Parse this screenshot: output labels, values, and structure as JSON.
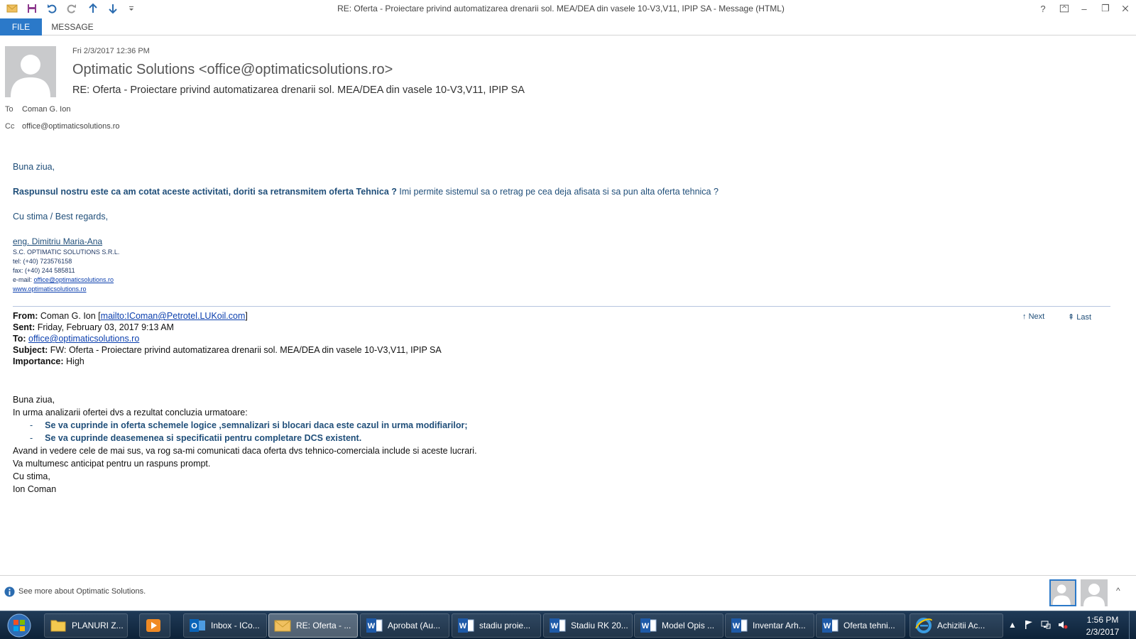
{
  "window": {
    "title": "RE: Oferta - Proiectare privind automatizarea drenarii sol. MEA/DEA din vasele 10-V3,V11, IPIP SA - Message (HTML)",
    "help": "?",
    "minimize": "–",
    "restore": "❐"
  },
  "ribbon": {
    "file_tab": "FILE",
    "message_tab": "MESSAGE"
  },
  "header": {
    "sent": "Fri 2/3/2017 12:36 PM",
    "sender": "Optimatic Solutions <office@optimaticsolutions.ro>",
    "subject": "RE: Oferta - Proiectare privind automatizarea drenarii sol. MEA/DEA din vasele 10-V3,V11, IPIP SA",
    "to_label": "To",
    "to_value": "Coman G. Ion",
    "cc_label": "Cc",
    "cc_value": "office@optimaticsolutions.ro"
  },
  "reply": {
    "greeting": "Buna ziua,",
    "bold_line": "Raspunsul nostru este ca am cotat aceste activitati, doriti sa retransmitem oferta Tehnica ?",
    "normal_line": " Imi permite sistemul sa o retrag pe cea deja afisata si sa pun alta oferta tehnica ?",
    "closing": "Cu stima / Best regards,",
    "signature": {
      "name": "eng. Dimitriu Maria-Ana",
      "company": "S.C. OPTIMATIC SOLUTIONS S.R.L.",
      "tel": "tel: (+40) 723576158",
      "fax": "fax:  (+40) 244 585811",
      "email_label": "e-mail: ",
      "email": "office@optimaticsolutions.ro",
      "website": "www.optimaticsolutions.ro"
    }
  },
  "forwarded": {
    "from_label": "From:",
    "from_value": " Coman G. Ion [",
    "from_link": "mailto:IComan@Petrotel.LUKoil.com",
    "from_close": "]",
    "sent_label": "Sent:",
    "sent_value": " Friday, February 03, 2017 9:13 AM",
    "to_label": "To:",
    "to_link": "office@optimaticsolutions.ro",
    "subject_label": "Subject:",
    "subject_value": " FW: Oferta - Proiectare privind automatizarea drenarii sol. MEA/DEA din vasele 10-V3,V11, IPIP SA",
    "importance_label": "Importance:",
    "importance_value": " High",
    "next": "Next",
    "last": "Last",
    "body": {
      "greeting": "Buna ziua,",
      "intro": "In urma analizarii ofertei dvs a rezultat concluzia urmatoare:",
      "bullet_dash": "-",
      "bullet1": "Se va cuprinde in oferta schemele logice ,semnalizari si blocari daca este cazul in urma modifiarilor;",
      "bullet2": "Se va cuprinde deasemenea si specificatii pentru completare DCS existent.",
      "line1": "Avand in vedere cele de mai sus, va rog sa-mi comunicati daca oferta dvs tehnico-comerciala include si aceste lucrari.",
      "line2": "Va multumesc anticipat pentru un raspuns prompt.",
      "line3": "Cu stima,",
      "line4": "Ion Coman"
    }
  },
  "people_pane": {
    "text": "See more about Optimatic Solutions."
  },
  "taskbar": {
    "items": [
      {
        "label": "PLANURI Z...",
        "icon": "folder-icon"
      },
      {
        "label": "",
        "icon": "media-player-icon"
      },
      {
        "label": "Inbox - ICo...",
        "icon": "outlook-icon"
      },
      {
        "label": "RE: Oferta - ...",
        "icon": "mail-icon"
      },
      {
        "label": "Aprobat (Au...",
        "icon": "word-icon"
      },
      {
        "label": "stadiu proie...",
        "icon": "word-icon"
      },
      {
        "label": "Stadiu RK 20...",
        "icon": "word-icon"
      },
      {
        "label": "Model Opis ...",
        "icon": "word-icon"
      },
      {
        "label": "Inventar Arh...",
        "icon": "word-icon"
      },
      {
        "label": "Oferta tehni...",
        "icon": "word-icon"
      },
      {
        "label": "Achizitii Ac...",
        "icon": "ie-icon"
      }
    ],
    "clock_time": "1:56 PM",
    "clock_date": "2/3/2017"
  },
  "colors": {
    "accent": "#2b79c9",
    "reply_text": "#1f4e79",
    "link": "#0b3fae"
  }
}
